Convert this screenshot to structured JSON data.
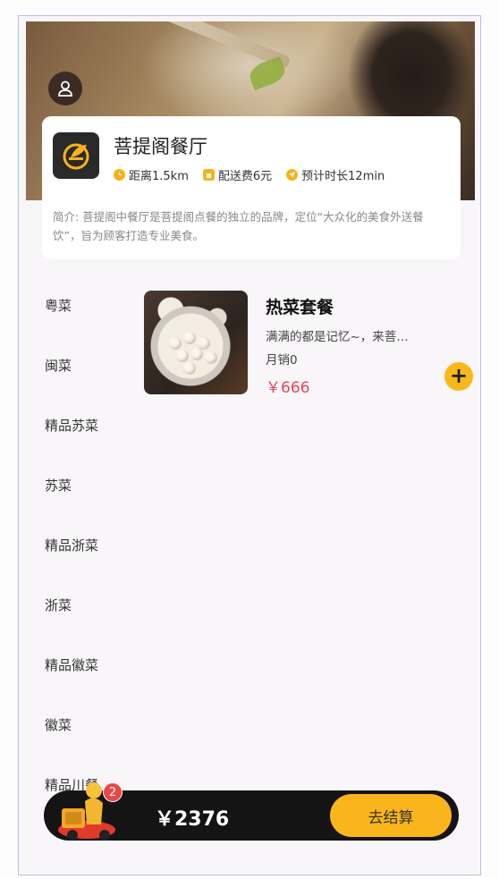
{
  "shop": {
    "name": "菩提阁餐厅",
    "distance": "距离1.5km",
    "delivery_fee": "配送费6元",
    "eta": "预计时长12min",
    "intro": "简介: 菩提阁中餐厅是菩提阁点餐的独立的品牌，定位“大众化的美食外送餐饮”，旨为顾客打造专业美食。"
  },
  "icons": {
    "user": "user-icon",
    "logo": "shop-logo",
    "clock": "clock-icon",
    "bag": "bag-icon",
    "location": "location-arrow-icon",
    "add": "plus-icon",
    "cart": "delivery-rider-icon"
  },
  "categories": [
    "粤菜",
    "闽菜",
    "精品苏菜",
    "苏菜",
    "精品浙菜",
    "浙菜",
    "精品徽菜",
    "徽菜",
    "精品川餐"
  ],
  "dish": {
    "title": "热菜套餐",
    "desc": "满满的都是记忆~，来菩…",
    "sales": "月销0",
    "price": "￥666",
    "add_label": "+"
  },
  "cart": {
    "count": "2",
    "total": "￥2376",
    "checkout_label": "去结算"
  },
  "colors": {
    "accent": "#fbb51c",
    "price": "#e0455a",
    "bar": "#141414",
    "badge": "#e94848"
  }
}
